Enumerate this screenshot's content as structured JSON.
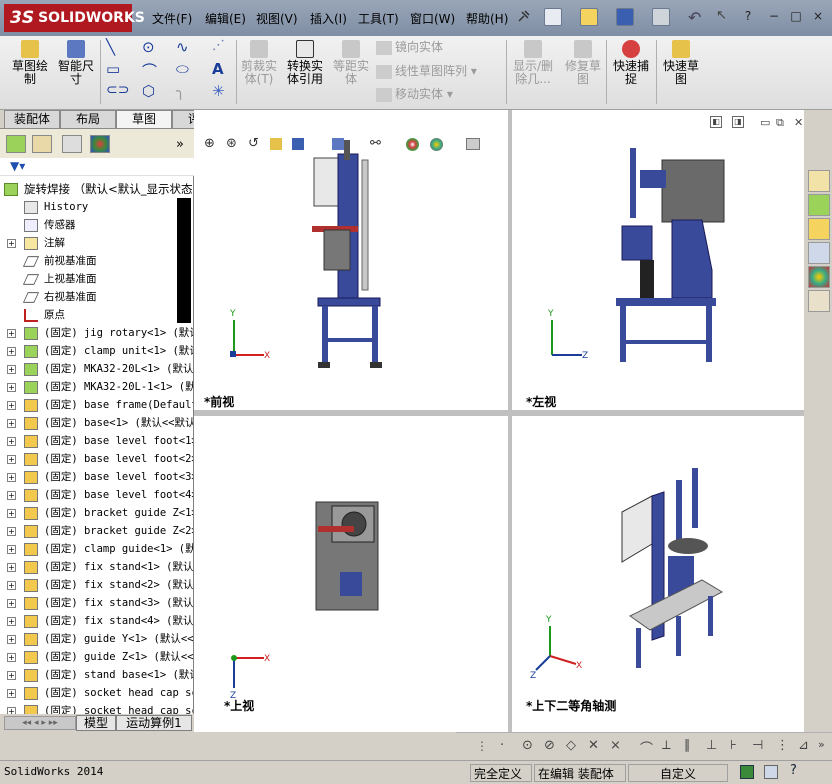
{
  "app": {
    "logo": "SOLIDWORKS",
    "logo_prefix": "3S"
  },
  "menu": [
    "文件(F)",
    "编辑(E)",
    "视图(V)",
    "插入(I)",
    "工具(T)",
    "窗口(W)",
    "帮助(H)"
  ],
  "window_controls": [
    "?",
    "−",
    "□",
    "×"
  ],
  "ribbon": {
    "sketch": "草图绘\n制",
    "smart_dim": "智能尺\n寸",
    "trim": "剪裁实\n体(T)",
    "convert": "转换实\n体引用",
    "offset": "等距实\n体",
    "mirror": "镜向实体",
    "linear_pattern": "线性草图阵列",
    "move": "移动实体",
    "show_delete": "显示/删\n除几...",
    "repair": "修复草\n图",
    "quick_snap": "快速捕\n捉",
    "rapid_sketch": "快速草\n图"
  },
  "tabs": [
    "装配体",
    "布局",
    "草图",
    "评估"
  ],
  "active_tab": "草图",
  "tree": {
    "root": "旋转焊接 （默认<默认_显示状态",
    "items": [
      {
        "label": "History",
        "icon": "history-icon"
      },
      {
        "label": "传感器",
        "icon": "sensor-icon"
      },
      {
        "label": "注解",
        "icon": "annotation-icon",
        "expand": true
      },
      {
        "label": "前视基准面",
        "icon": "plane-icon"
      },
      {
        "label": "上视基准面",
        "icon": "plane-icon"
      },
      {
        "label": "右视基准面",
        "icon": "plane-icon"
      },
      {
        "label": "原点",
        "icon": "origin-icon"
      },
      {
        "label": "(固定) jig rotary<1> (默认",
        "icon": "part-green-icon",
        "expand": true
      },
      {
        "label": "(固定) clamp unit<1> (默认",
        "icon": "part-green-icon",
        "expand": true
      },
      {
        "label": "(固定) MKA32-20L<1> (默认",
        "icon": "part-green-icon",
        "expand": true
      },
      {
        "label": "(固定) MKA32-20L-1<1> (默",
        "icon": "part-green-icon",
        "expand": true
      },
      {
        "label": "(固定) base frame(Default<",
        "icon": "part-yellow-icon",
        "expand": true
      },
      {
        "label": "(固定) base<1> (默认<<默认",
        "icon": "part-yellow-icon",
        "expand": true
      },
      {
        "label": "(固定) base level foot<1>",
        "icon": "part-yellow-icon",
        "expand": true
      },
      {
        "label": "(固定) base level foot<2>",
        "icon": "part-yellow-icon",
        "expand": true
      },
      {
        "label": "(固定) base level foot<3>",
        "icon": "part-yellow-icon",
        "expand": true
      },
      {
        "label": "(固定) base level foot<4>",
        "icon": "part-yellow-icon",
        "expand": true
      },
      {
        "label": "(固定) bracket guide Z<1>",
        "icon": "part-yellow-icon",
        "expand": true
      },
      {
        "label": "(固定) bracket guide Z<2>",
        "icon": "part-yellow-icon",
        "expand": true
      },
      {
        "label": "(固定) clamp guide<1> (默",
        "icon": "part-yellow-icon",
        "expand": true
      },
      {
        "label": "(固定) fix stand<1> (默认",
        "icon": "part-yellow-icon",
        "expand": true
      },
      {
        "label": "(固定) fix stand<2> (默认",
        "icon": "part-yellow-icon",
        "expand": true
      },
      {
        "label": "(固定) fix stand<3> (默认",
        "icon": "part-yellow-icon",
        "expand": true
      },
      {
        "label": "(固定) fix stand<4> (默认",
        "icon": "part-yellow-icon",
        "expand": true
      },
      {
        "label": "(固定) guide Y<1> (默认<<",
        "icon": "part-yellow-icon",
        "expand": true
      },
      {
        "label": "(固定) guide Z<1> (默认<<",
        "icon": "part-yellow-icon",
        "expand": true
      },
      {
        "label": "(固定) stand base<1> (默认",
        "icon": "part-yellow-icon",
        "expand": true
      },
      {
        "label": "(固定) socket head cap sc",
        "icon": "part-yellow-icon",
        "expand": true
      },
      {
        "label": "(固定) socket head cap sc",
        "icon": "part-yellow-icon",
        "expand": true
      }
    ]
  },
  "bottom_tabs": [
    "模型",
    "运动算例1"
  ],
  "views": {
    "front": "*前视",
    "left": "*左视",
    "top": "*上视",
    "iso": "*上下二等角轴测"
  },
  "axes": {
    "x": "X",
    "y": "Y",
    "z": "Z"
  },
  "status": {
    "app": "SolidWorks 2014",
    "defined": "完全定义",
    "editing": "在编辑 装配体",
    "custom": "自定义",
    "help": "?"
  },
  "colors": {
    "accent": "#b0191f",
    "machine_blue": "#3a4a9a",
    "frame_gray": "#c8c8c8"
  }
}
